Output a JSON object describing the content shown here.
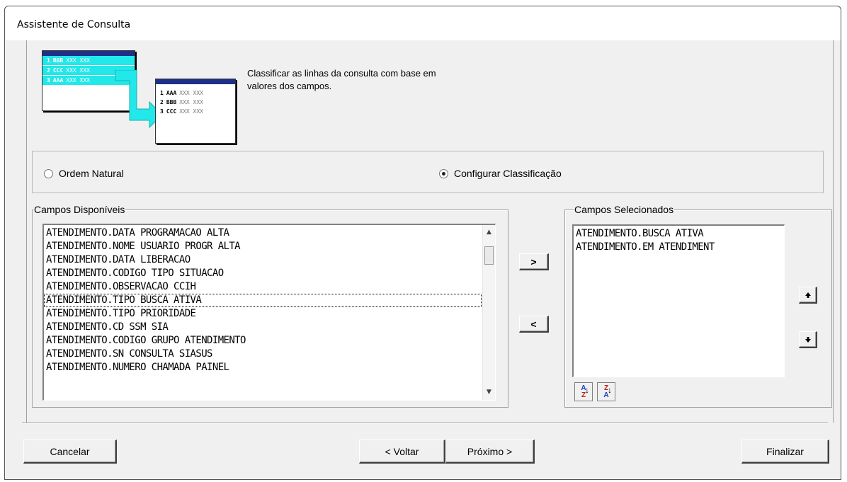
{
  "window": {
    "title": "Assistente de Consulta"
  },
  "illustration": {
    "unsorted_rows": [
      {
        "num": "1",
        "code": "BBB",
        "filler": "XXX XXX"
      },
      {
        "num": "2",
        "code": "CCC",
        "filler": "XXX XXX"
      },
      {
        "num": "3",
        "code": "AAA",
        "filler": "XXX XXX"
      }
    ],
    "sorted_rows": [
      {
        "num": "1",
        "code": "AAA",
        "filler": "XXX XXX"
      },
      {
        "num": "2",
        "code": "BBB",
        "filler": "XXX XXX"
      },
      {
        "num": "3",
        "code": "CCC",
        "filler": "XXX XXX"
      }
    ]
  },
  "description": {
    "line1": "Classificar as linhas da consulta com base em",
    "line2": "valores dos campos."
  },
  "order_options": {
    "natural": {
      "label": "Ordem Natural",
      "selected": false
    },
    "custom": {
      "label": "Configurar Classificação",
      "selected": true
    }
  },
  "available_fields": {
    "label": "Campos Disponíveis",
    "items": [
      "ATENDIMENTO.DATA PROGRAMACAO ALTA",
      "ATENDIMENTO.NOME USUARIO PROGR ALTA",
      "ATENDIMENTO.DATA LIBERACAO",
      "ATENDIMENTO.CODIGO TIPO SITUACAO",
      "ATENDIMENTO.OBSERVACAO CCIH",
      "ATENDIMENTO.TIPO BUSCA ATIVA",
      "ATENDIMENTO.TIPO PRIORIDADE",
      "ATENDIMENTO.CD SSM SIA",
      "ATENDIMENTO.CODIGO GRUPO ATENDIMENTO",
      "ATENDIMENTO.SN CONSULTA SIASUS",
      "ATENDIMENTO.NUMERO CHAMADA PAINEL"
    ],
    "focused_index": 5
  },
  "transfer": {
    "add_label": ">",
    "remove_label": "<"
  },
  "selected_fields": {
    "label": "Campos Selecionados",
    "items": [
      "ATENDIMENTO.BUSCA ATIVA",
      "ATENDIMENTO.EM ATENDIMENT"
    ]
  },
  "reorder": {
    "up_icon": "arrow-up-icon",
    "down_icon": "arrow-down-icon"
  },
  "sort": {
    "ascending": {
      "top": "A",
      "bottom": "Z",
      "icon": "sort-ascending-icon"
    },
    "descending": {
      "top": "Z",
      "bottom": "A",
      "icon": "sort-descending-icon"
    }
  },
  "buttons": {
    "cancel": "Cancelar",
    "back": "< Voltar",
    "next": "Próximo >",
    "finish": "Finalizar"
  }
}
